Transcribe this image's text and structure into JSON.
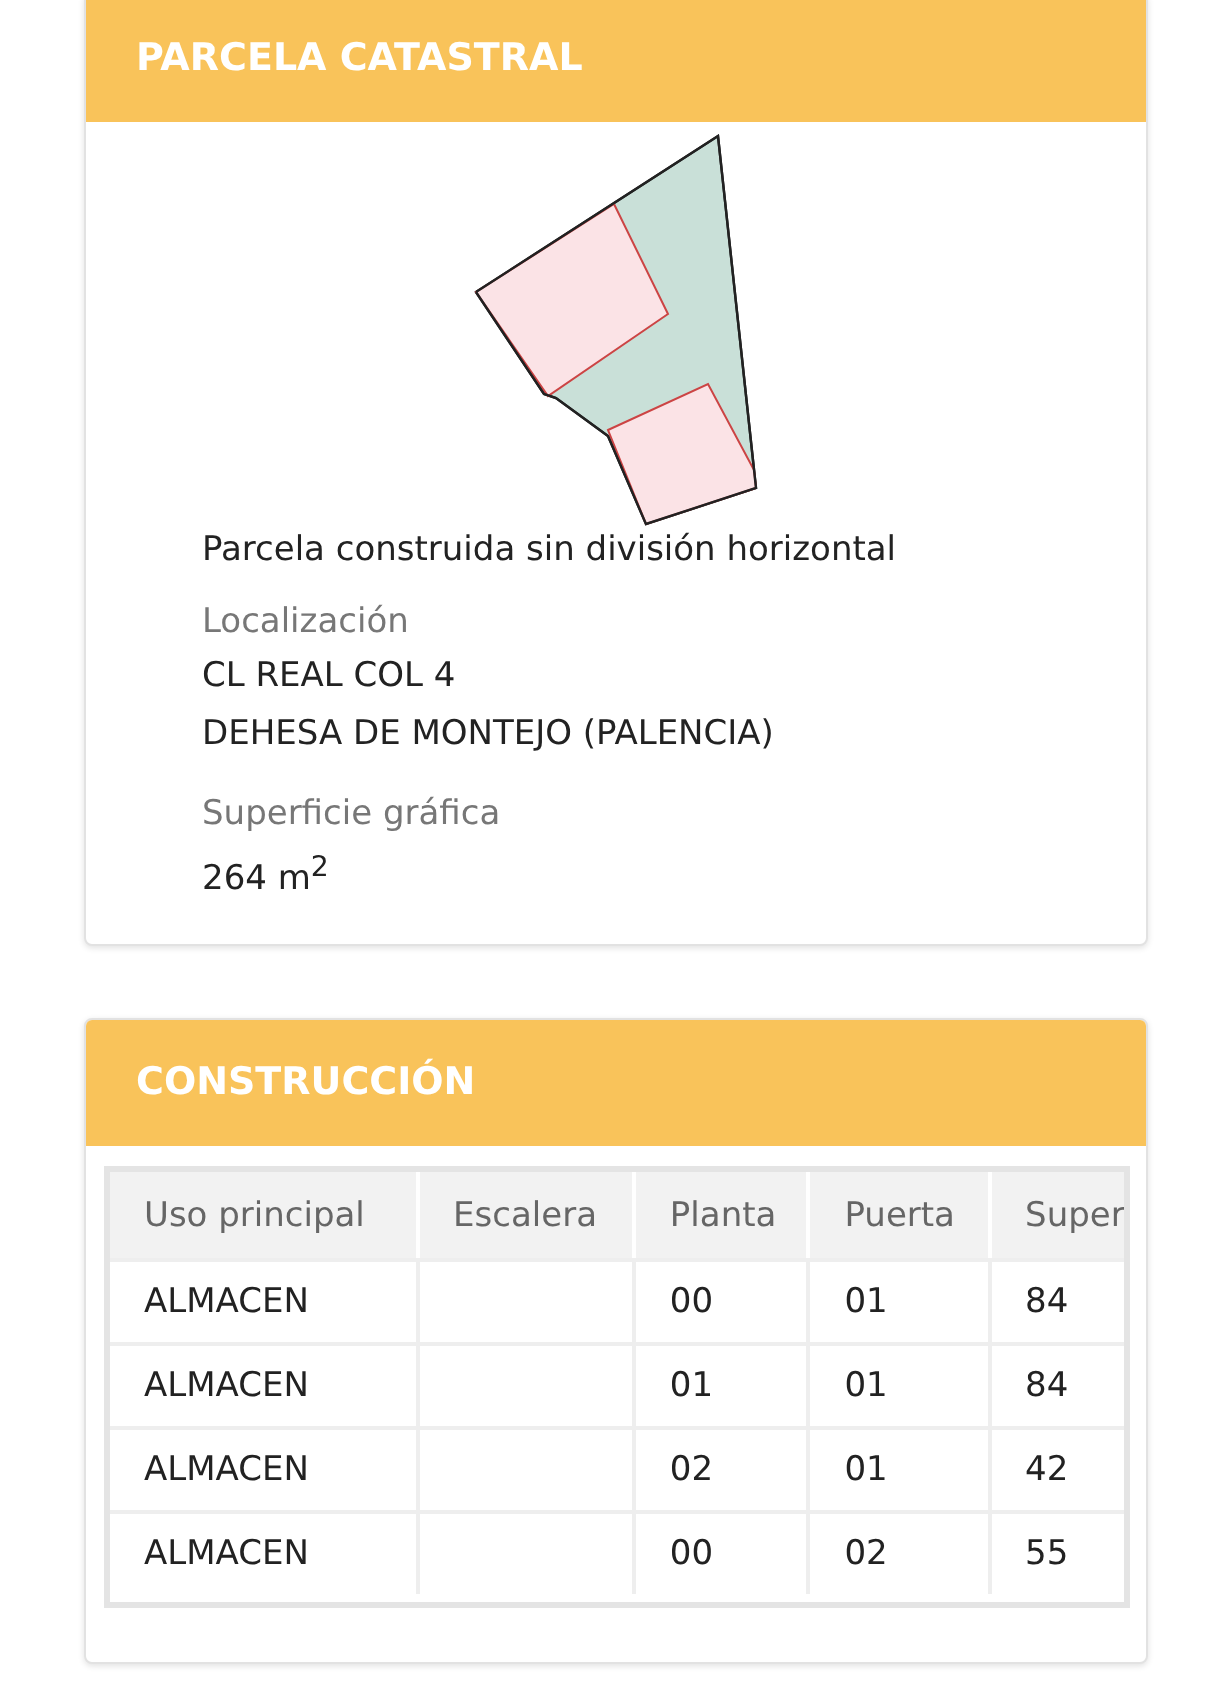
{
  "parcel": {
    "title": "PARCELA CATASTRAL",
    "picture": {
      "kind": "parcel-plan"
    },
    "type": "Parcela construida sin división horizontal",
    "fields": [
      {
        "label": "Localización",
        "lines": [
          "CL REAL COL 4",
          "DEHESA DE MONTEJO (PALENCIA)"
        ]
      },
      {
        "label": "Superficie gráfica",
        "lines": [
          "264 m$^{2}$"
        ]
      }
    ]
  },
  "construction": {
    "title": "CONSTRUCCIÓN",
    "table": {
      "columns": [
        "Uso principal",
        "Escalera",
        "Planta",
        "Puerta",
        "Super"
      ],
      "rows": [
        [
          "ALMACEN",
          "",
          "00",
          "01",
          "84"
        ],
        [
          "ALMACEN",
          "",
          "01",
          "01",
          "84"
        ],
        [
          "ALMACEN",
          "",
          "02",
          "01",
          "42"
        ],
        [
          "ALMACEN",
          "",
          "00",
          "02",
          "55"
        ]
      ]
    }
  }
}
